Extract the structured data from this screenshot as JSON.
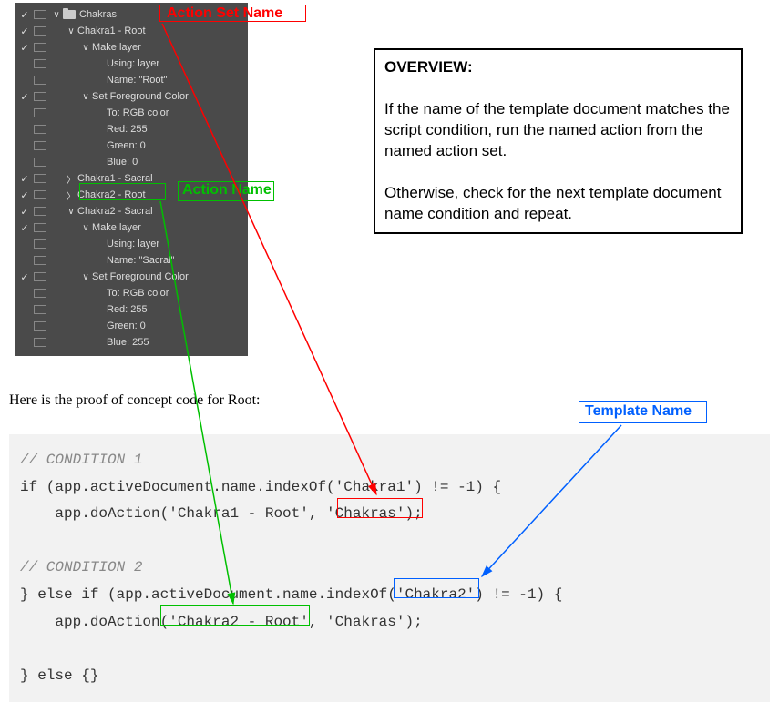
{
  "actions_panel": {
    "set_name": "Chakras",
    "rows": [
      {
        "check": "✓",
        "chev": "∨",
        "folder": true,
        "label": "Chakras",
        "indent": 1
      },
      {
        "check": "✓",
        "chev": "∨",
        "label": "Chakra1 - Root",
        "indent": 2
      },
      {
        "check": "✓",
        "chev": "∨",
        "label": "Make layer",
        "indent": 3
      },
      {
        "check": "",
        "label": "Using: layer",
        "indent": 4
      },
      {
        "check": "",
        "label": "Name: \"Root\"",
        "indent": 4
      },
      {
        "check": "✓",
        "chev": "∨",
        "label": "Set Foreground Color",
        "indent": 3
      },
      {
        "check": "",
        "label": "To: RGB color",
        "indent": 4
      },
      {
        "check": "",
        "label": "Red: 255",
        "indent": 4
      },
      {
        "check": "",
        "label": "Green: 0",
        "indent": 4
      },
      {
        "check": "",
        "label": "Blue: 0",
        "indent": 4
      },
      {
        "check": "✓",
        "chev": "〉",
        "label": "Chakra1 - Sacral",
        "indent": 2
      },
      {
        "check": "✓",
        "chev": "〉",
        "label": "Chakra2 - Root",
        "indent": 2
      },
      {
        "check": "✓",
        "chev": "∨",
        "label": "Chakra2 - Sacral",
        "indent": 2
      },
      {
        "check": "✓",
        "chev": "∨",
        "label": "Make layer",
        "indent": 3
      },
      {
        "check": "",
        "label": "Using: layer",
        "indent": 4
      },
      {
        "check": "",
        "label": "Name: \"Sacral\"",
        "indent": 4
      },
      {
        "check": "✓",
        "chev": "∨",
        "label": "Set Foreground Color",
        "indent": 3
      },
      {
        "check": "",
        "label": "To: RGB color",
        "indent": 4
      },
      {
        "check": "",
        "label": "Red: 255",
        "indent": 4
      },
      {
        "check": "",
        "label": "Green: 0",
        "indent": 4
      },
      {
        "check": "",
        "label": "Blue: 255",
        "indent": 4
      }
    ]
  },
  "callouts": {
    "action_set_name": "Action Set Name",
    "action_name": "Action Name",
    "template_name": "Template Name"
  },
  "overview": {
    "title": "OVERVIEW:",
    "p1": "If the name of the template document matches the script condition, run the named action from the named action set.",
    "p2": "Otherwise, check for the next template document name condition and repeat."
  },
  "body_text": "Here is the proof of concept code for Root:",
  "code": {
    "c1": "// CONDITION 1",
    "l1": "if (app.activeDocument.name.indexOf('Chakra1') != -1) {",
    "l2": "    app.doAction('Chakra1 - Root', 'Chakras');",
    "blank": " ",
    "c2": "// CONDITION 2",
    "l3": "} else if (app.activeDocument.name.indexOf('Chakra2') != -1) {",
    "l4": "    app.doAction('Chakra2 - Root', 'Chakras');",
    "l5": "} else {}"
  },
  "colors": {
    "red": "#ff0000",
    "green": "#00c000",
    "blue": "#0060ff"
  }
}
